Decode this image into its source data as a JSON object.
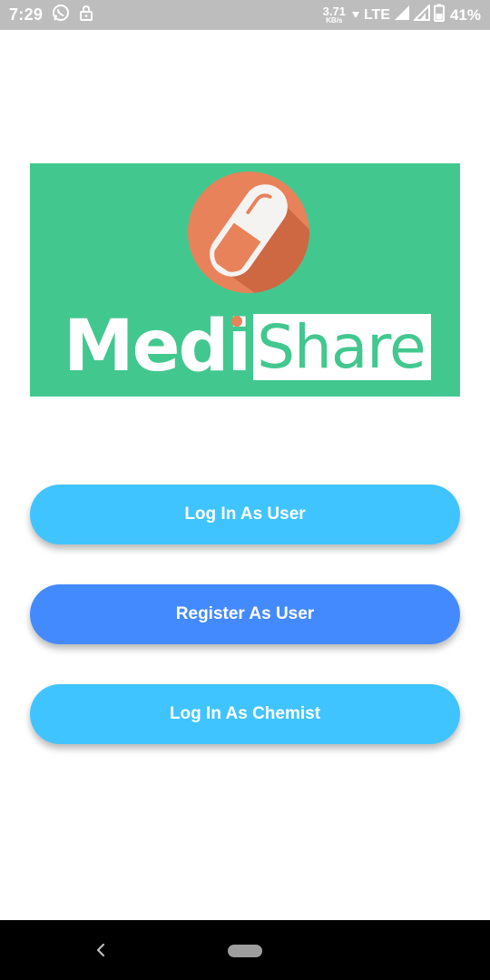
{
  "status_bar": {
    "time": "7:29",
    "speed_value": "3.71",
    "speed_unit": "KB/s",
    "network": "LTE",
    "battery": "41%",
    "icons": [
      "whatsapp-icon",
      "lock-icon",
      "data-arrow-icon",
      "signal-icon",
      "signal-icon",
      "battery-icon"
    ]
  },
  "logo": {
    "word_left": "Medi",
    "word_right": "Share",
    "colors": {
      "banner": "#42c88f",
      "pill_circle": "#e8825a",
      "wordmark_white": "#ffffff"
    }
  },
  "buttons": {
    "login_user": "Log In As User",
    "register_user": "Register As User",
    "login_chemist": "Log In As Chemist"
  },
  "colors": {
    "light_blue": "#40c4ff",
    "blue": "#448aff",
    "status_bar": "#bdbdbd",
    "nav_bar": "#000000"
  },
  "nav_bar": {
    "icons": [
      "back-icon",
      "home-pill-icon"
    ]
  }
}
